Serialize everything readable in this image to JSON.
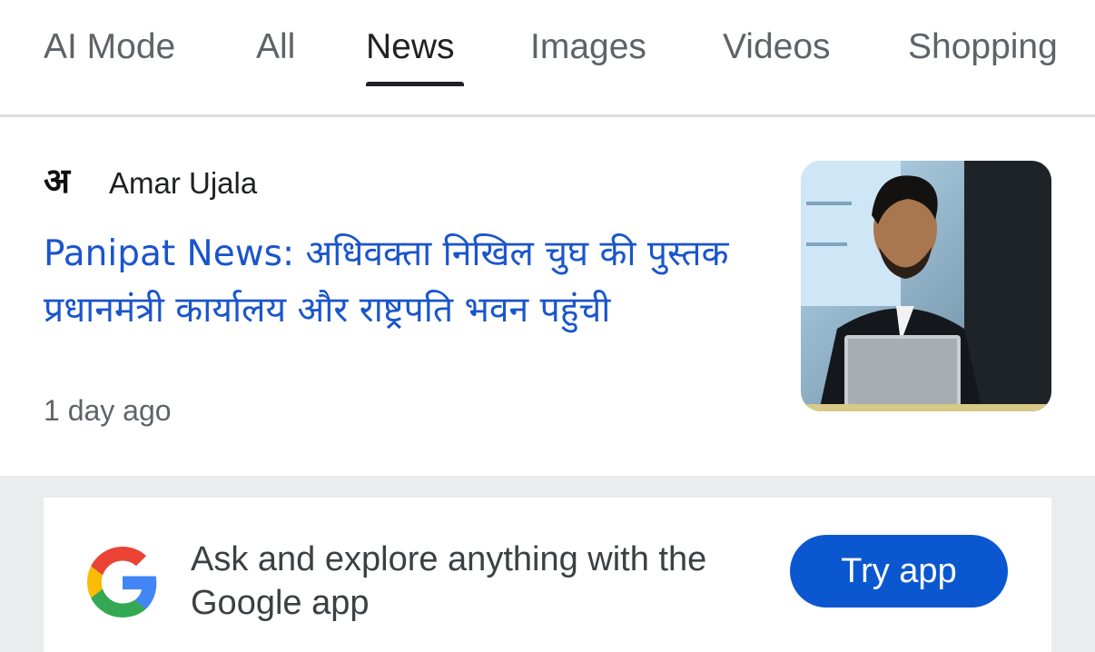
{
  "tabs": [
    {
      "label": "AI Mode"
    },
    {
      "label": "All"
    },
    {
      "label": "News"
    },
    {
      "label": "Images"
    },
    {
      "label": "Videos"
    },
    {
      "label": "Shopping"
    }
  ],
  "active_tab": "News",
  "article": {
    "source_logo": "अ",
    "source_name": "Amar Ujala",
    "headline": "Panipat News: अधिवक्ता निखिल चुघ की पुस्तक प्रधानमंत्री कार्यालय और राष्ट्रपति भवन पहुंची",
    "timestamp": "1 day ago"
  },
  "promo": {
    "text": "Ask and explore anything with the Google app",
    "button_label": "Try app"
  },
  "colors": {
    "link_blue": "#1a55cc",
    "button_blue": "#0b57d0",
    "tab_active": "#202124",
    "tab_inactive": "#5f6368"
  }
}
